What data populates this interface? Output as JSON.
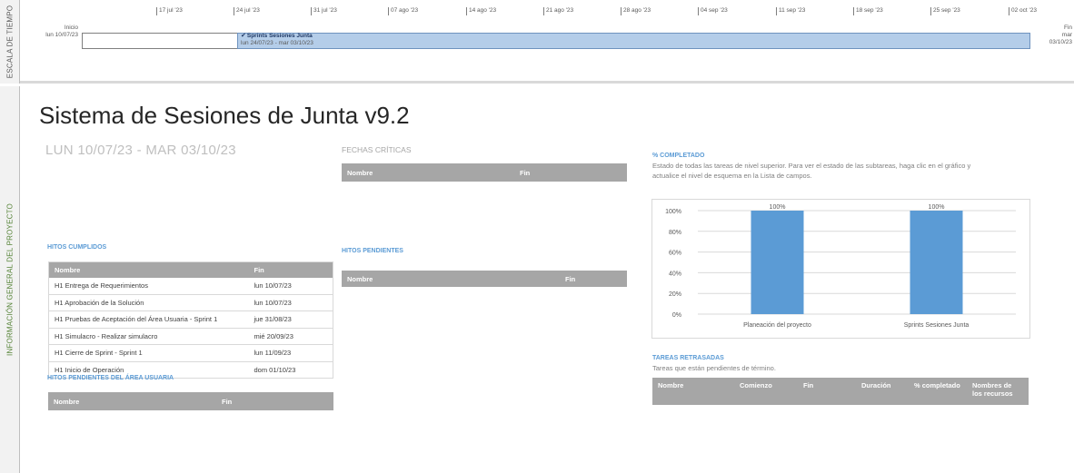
{
  "timeline": {
    "side_label": "ESCALA DE TIEMPO",
    "start_label": "Inicio",
    "start_date": "lun 10/07/23",
    "end_label": "Fin",
    "end_date": "mar 03/10/23",
    "ticks": [
      "17 jul '23",
      "24 jul '23",
      "31 jul '23",
      "07 ago '23",
      "14 ago '23",
      "21 ago '23",
      "28 ago '23",
      "04 sep '23",
      "11 sep '23",
      "18 sep '23",
      "25 sep '23",
      "02 oct '23"
    ],
    "bar": {
      "name": "Sprints Sesiones Junta",
      "dates": "lun 24/07/23 - mar 03/10/23",
      "color": "#b4cde9"
    }
  },
  "report": {
    "side_label": "INFORMACIÓN GENERAL DEL PROYECTO",
    "title": "Sistema de Sesiones de Junta v9.2",
    "date_range": "LUN 10/07/23 -  MAR 03/10/23",
    "critical_dates": {
      "heading": "FECHAS CRÍTICAS",
      "columns": [
        "Nombre",
        "Fin"
      ]
    },
    "completed_milestones": {
      "heading": "HITOS CUMPLIDOS",
      "columns": [
        "Nombre",
        "Fin"
      ],
      "rows": [
        [
          "H1 Entrega de Requerimientos",
          "lun 10/07/23"
        ],
        [
          "H1 Aprobación de la Solución",
          "lun 10/07/23"
        ],
        [
          "H1 Pruebas de Aceptación del Área Usuaria - Sprint 1",
          "jue 31/08/23"
        ],
        [
          "H1 Simulacro - Realizar simulacro",
          "mié 20/09/23"
        ],
        [
          "H1 Cierre de Sprint - Sprint 1",
          "lun 11/09/23"
        ],
        [
          "H1 Inicio de Operación",
          "dom 01/10/23"
        ]
      ]
    },
    "pending_user_milestones": {
      "heading": "HITOS PENDIENTES DEL ÁREA USUARIA",
      "columns": [
        "Nombre",
        "Fin"
      ]
    },
    "pending_milestones": {
      "heading": "HITOS PENDIENTES",
      "columns": [
        "Nombre",
        "Fin"
      ]
    },
    "percent_complete": {
      "heading": "% COMPLETADO",
      "description": "Estado de todas las tareas de nivel superior. Para ver el estado de las subtareas, haga clic en el gráfico y actualice el nivel de esquema en la Lista de campos."
    },
    "late_tasks": {
      "heading": "TAREAS RETRASADAS",
      "subtitle": "Tareas que están pendientes de término.",
      "columns": [
        "Nombre",
        "Comienzo",
        "Fin",
        "Duración",
        "% completado",
        "Nombres de los recursos"
      ]
    }
  },
  "chart_data": {
    "type": "bar",
    "categories": [
      "Planeación del proyecto",
      "Sprints Sesiones Junta"
    ],
    "values": [
      100,
      100
    ],
    "data_labels": [
      "100%",
      "100%"
    ],
    "ylim": [
      0,
      100
    ],
    "yticks": [
      "0%",
      "20%",
      "40%",
      "60%",
      "80%",
      "100%"
    ],
    "title": "",
    "xlabel": "",
    "ylabel": "",
    "grid": true,
    "bar_color": "#5b9bd5"
  }
}
